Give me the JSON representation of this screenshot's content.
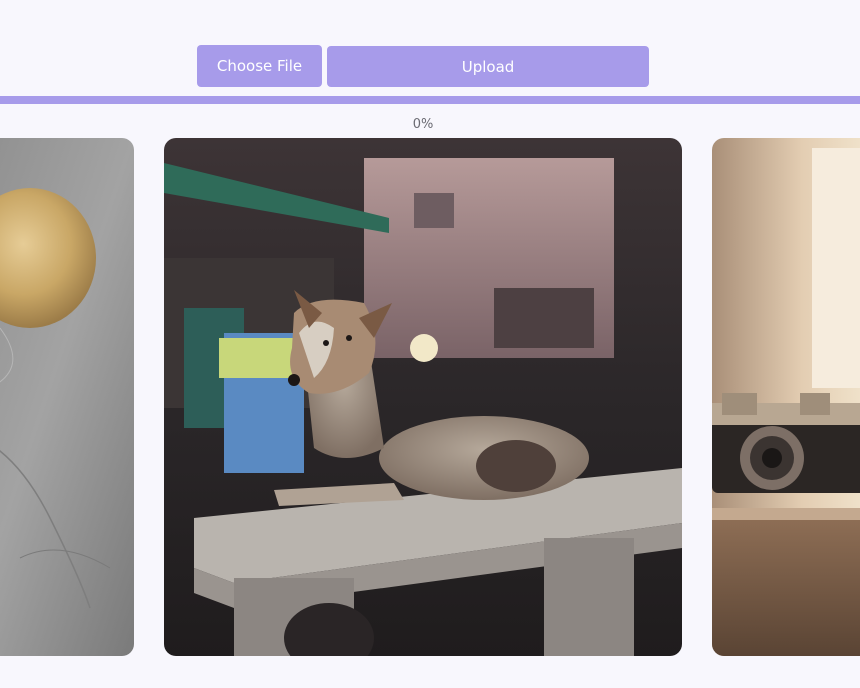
{
  "upload_controls": {
    "choose_file_label": "Choose File",
    "upload_label": "Upload"
  },
  "progress": {
    "text": "0%",
    "value": 0
  },
  "gallery": {
    "images": [
      {
        "name": "bread-photo"
      },
      {
        "name": "dog-on-bench-photo"
      },
      {
        "name": "vintage-camera-photo"
      }
    ]
  },
  "colors": {
    "accent": "#a79bea",
    "background": "#f8f7fd",
    "muted_text": "#6b6b73"
  }
}
